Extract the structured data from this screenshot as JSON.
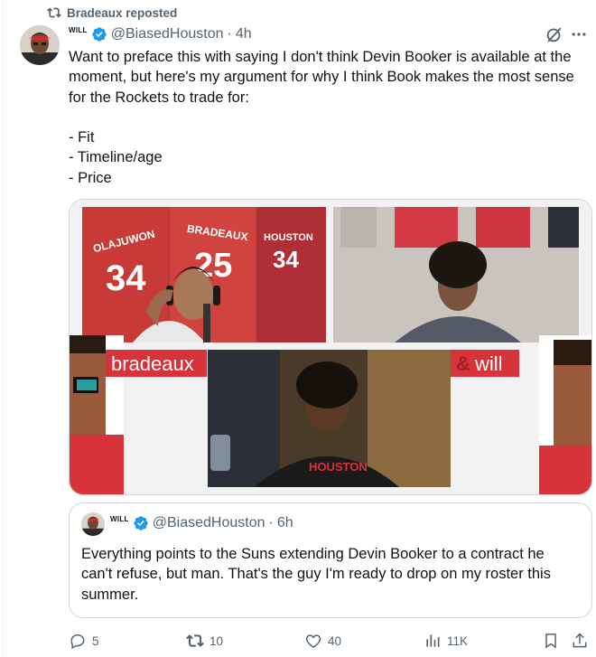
{
  "repost": {
    "label": "Bradeaux reposted",
    "icon": "repost-icon"
  },
  "tweet": {
    "display_name": "WILL",
    "handle": "@BiasedHouston",
    "separator": "·",
    "time": "4h",
    "text": "Want to preface this with saying I don't think Devin Booker is available at the moment, but here's my argument for why I think Book makes the most sense for the Rockets to trade for:\n\n- Fit\n- Timeline/age\n- Price",
    "media": {
      "left_overlay": "bradeaux",
      "right_overlay_amp": "&",
      "right_overlay_word": "will",
      "jersey_texts": [
        "OLAJUWON",
        "BRADEAUX",
        "HOUSTON"
      ],
      "jersey_numbers": [
        "34",
        "25",
        "34"
      ],
      "shirt_text": "HOUSTON"
    }
  },
  "quoted": {
    "display_name": "WILL",
    "handle": "@BiasedHouston",
    "separator": "·",
    "time": "6h",
    "text": "Everything points to the Suns extending Devin Booker to a contract he can't refuse, but man. That's the guy I'm ready to drop on my roster this summer."
  },
  "actions": {
    "reply_count": "5",
    "repost_count": "10",
    "like_count": "40",
    "views_count": "11K"
  },
  "colors": {
    "accent": "#1d9bf0",
    "muted": "#536471",
    "overlay_red": "#d8323a",
    "border": "#cfd9de"
  }
}
